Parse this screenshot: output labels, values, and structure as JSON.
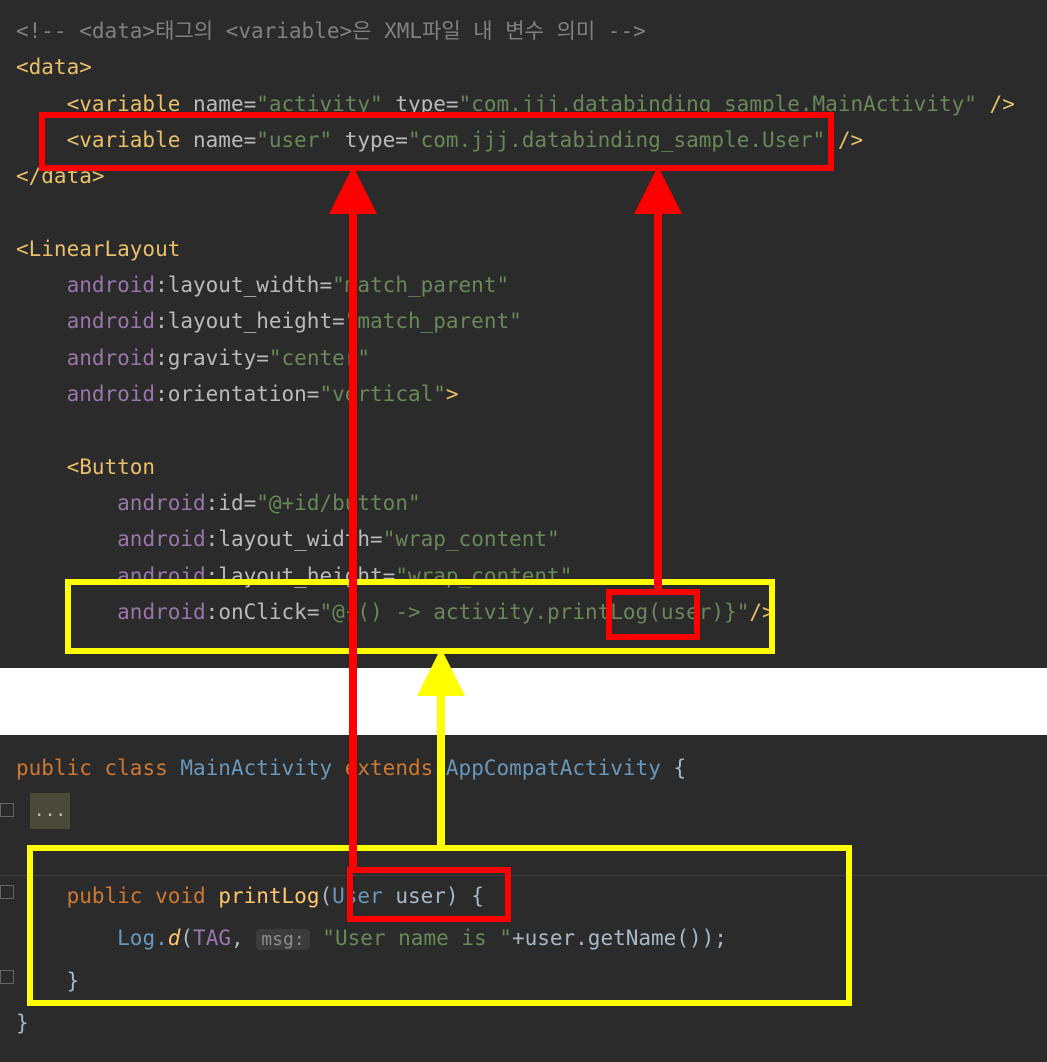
{
  "xml_editor": {
    "lines": [
      {
        "segments": [
          {
            "text": "<!-- <data>태그의 <variable>은 XML파일 내 변수 의미 -->",
            "cls": "cmt"
          }
        ]
      },
      {
        "segments": [
          {
            "text": "<data>",
            "cls": "tag"
          }
        ]
      },
      {
        "segments": [
          {
            "text": "    "
          },
          {
            "text": "<variable ",
            "cls": "tag"
          },
          {
            "text": "name=",
            "cls": "attr"
          },
          {
            "text": "\"activity\"",
            "cls": "val"
          },
          {
            "text": " type=",
            "cls": "attr"
          },
          {
            "text": "\"com.jjj.databinding_sample.MainActivity\"",
            "cls": "val"
          },
          {
            "text": " />",
            "cls": "tag"
          }
        ]
      },
      {
        "segments": [
          {
            "text": "    "
          },
          {
            "text": "<variable ",
            "cls": "tag"
          },
          {
            "text": "name=",
            "cls": "attr"
          },
          {
            "text": "\"user\"",
            "cls": "val"
          },
          {
            "text": " type=",
            "cls": "attr"
          },
          {
            "text": "\"com.jjj.databinding_sample.User\"",
            "cls": "val"
          },
          {
            "text": " />",
            "cls": "tag"
          }
        ]
      },
      {
        "segments": [
          {
            "text": "</data>",
            "cls": "tag"
          }
        ]
      },
      {
        "segments": [
          {
            "text": ""
          }
        ]
      },
      {
        "segments": [
          {
            "text": "<LinearLayout",
            "cls": "tag"
          }
        ]
      },
      {
        "segments": [
          {
            "text": "    "
          },
          {
            "text": "android",
            "cls": "ns"
          },
          {
            "text": ":layout_width=",
            "cls": "attr"
          },
          {
            "text": "\"match_parent\"",
            "cls": "val"
          }
        ]
      },
      {
        "segments": [
          {
            "text": "    "
          },
          {
            "text": "android",
            "cls": "ns"
          },
          {
            "text": ":layout_height=",
            "cls": "attr"
          },
          {
            "text": "\"match_parent\"",
            "cls": "val"
          }
        ]
      },
      {
        "segments": [
          {
            "text": "    "
          },
          {
            "text": "android",
            "cls": "ns"
          },
          {
            "text": ":gravity=",
            "cls": "attr"
          },
          {
            "text": "\"center\"",
            "cls": "val"
          }
        ]
      },
      {
        "segments": [
          {
            "text": "    "
          },
          {
            "text": "android",
            "cls": "ns"
          },
          {
            "text": ":orientation=",
            "cls": "attr"
          },
          {
            "text": "\"vertical\"",
            "cls": "val"
          },
          {
            "text": ">",
            "cls": "tag"
          }
        ]
      },
      {
        "segments": [
          {
            "text": ""
          }
        ]
      },
      {
        "segments": [
          {
            "text": "    "
          },
          {
            "text": "<Button",
            "cls": "tag"
          }
        ]
      },
      {
        "segments": [
          {
            "text": "        "
          },
          {
            "text": "android",
            "cls": "ns"
          },
          {
            "text": ":id=",
            "cls": "attr"
          },
          {
            "text": "\"@+id/button\"",
            "cls": "val"
          }
        ]
      },
      {
        "segments": [
          {
            "text": "        "
          },
          {
            "text": "android",
            "cls": "ns"
          },
          {
            "text": ":layout_width=",
            "cls": "attr"
          },
          {
            "text": "\"wrap_content\"",
            "cls": "val"
          }
        ]
      },
      {
        "segments": [
          {
            "text": "        "
          },
          {
            "text": "android",
            "cls": "ns"
          },
          {
            "text": ":layout_height=",
            "cls": "attr"
          },
          {
            "text": "\"wrap_content\"",
            "cls": "val"
          }
        ]
      },
      {
        "segments": [
          {
            "text": "        "
          },
          {
            "text": "android",
            "cls": "ns"
          },
          {
            "text": ":onClick=",
            "cls": "attr"
          },
          {
            "text": "\"@{() -> activity.printLog(user)}\"",
            "cls": "val"
          },
          {
            "text": "/>",
            "cls": "tag"
          }
        ]
      }
    ]
  },
  "java_editor": {
    "fold_placeholder": "...",
    "lines": [
      {
        "segments": [
          {
            "text": "public ",
            "cls": "kw"
          },
          {
            "text": "class ",
            "cls": "kw"
          },
          {
            "text": "MainActivity ",
            "cls": "cls"
          },
          {
            "text": "extends ",
            "cls": "kw"
          },
          {
            "text": "AppCompatActivity ",
            "cls": "cls"
          },
          {
            "text": "{"
          }
        ]
      },
      {
        "segments": [
          {
            "text": ""
          }
        ]
      },
      {
        "segments": [
          {
            "text": ""
          }
        ]
      },
      {
        "segments": [
          {
            "text": "    "
          },
          {
            "text": "public ",
            "cls": "kw"
          },
          {
            "text": "void ",
            "cls": "kw"
          },
          {
            "text": "printLog",
            "cls": "fn"
          },
          {
            "text": "("
          },
          {
            "text": "User ",
            "cls": "cls"
          },
          {
            "text": "user) {"
          }
        ]
      },
      {
        "segments": [
          {
            "text": "        "
          },
          {
            "text": "Log.",
            "cls": "cls"
          },
          {
            "text": "d",
            "cls": "fn ital"
          },
          {
            "text": "("
          },
          {
            "text": "TAG",
            "cls": "ns"
          },
          {
            "text": ", "
          },
          {
            "text": "msg:",
            "cls": "hint"
          },
          {
            "text": " "
          },
          {
            "text": "\"User name is \"",
            "cls": "val"
          },
          {
            "text": "+user.getName());"
          }
        ]
      },
      {
        "segments": [
          {
            "text": "    }"
          }
        ]
      },
      {
        "segments": [
          {
            "text": "}"
          }
        ]
      }
    ]
  },
  "colors": {
    "red": "#ff0000",
    "yellow": "#ffff00",
    "editor_bg": "#2b2b2b"
  }
}
